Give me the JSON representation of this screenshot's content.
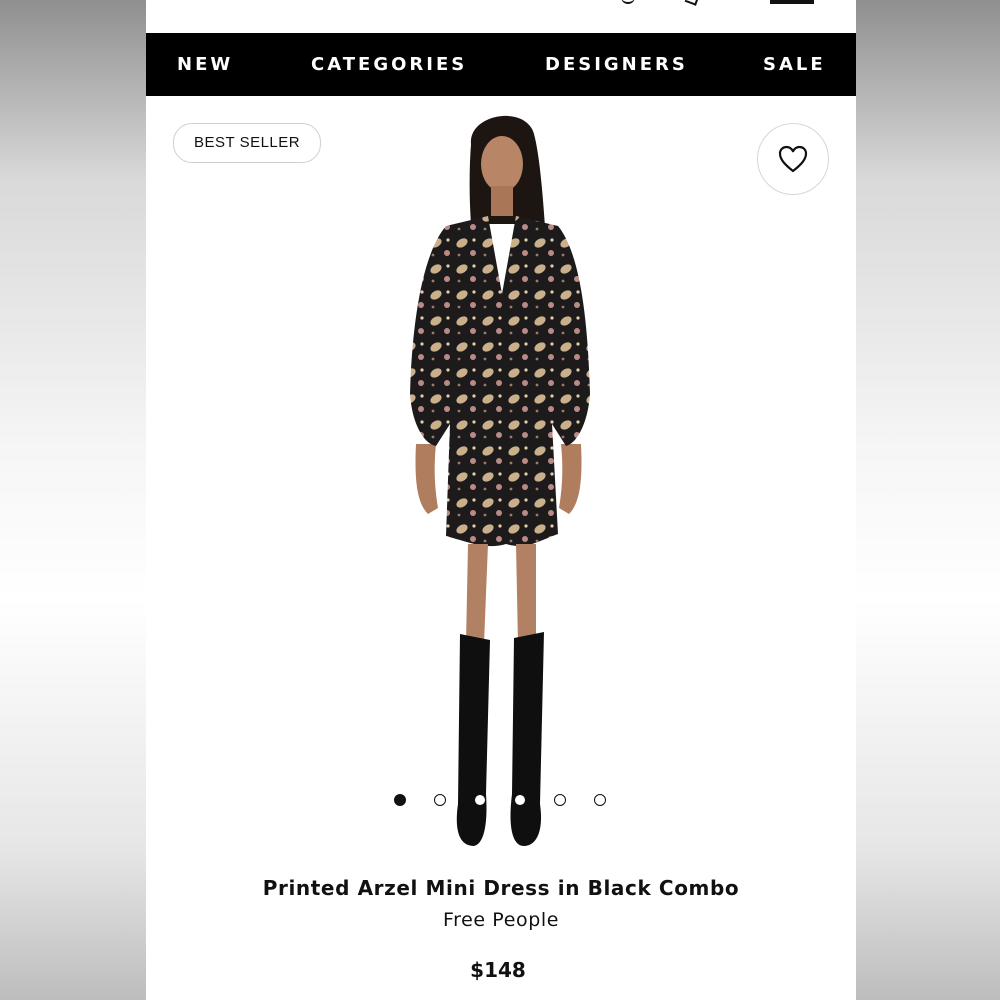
{
  "nav": {
    "items": [
      "NEW",
      "CATEGORIES",
      "DESIGNERS",
      "SALE"
    ]
  },
  "product": {
    "badge": "BEST SELLER",
    "title": "Printed Arzel Mini Dress in Black Combo",
    "brand": "Free People",
    "price": "$148",
    "image_count": 6,
    "active_image_index": 0
  },
  "icons": {
    "wishlist": "heart-icon"
  },
  "colors": {
    "nav_background": "#000000",
    "nav_text": "#ffffff",
    "text": "#111111"
  }
}
